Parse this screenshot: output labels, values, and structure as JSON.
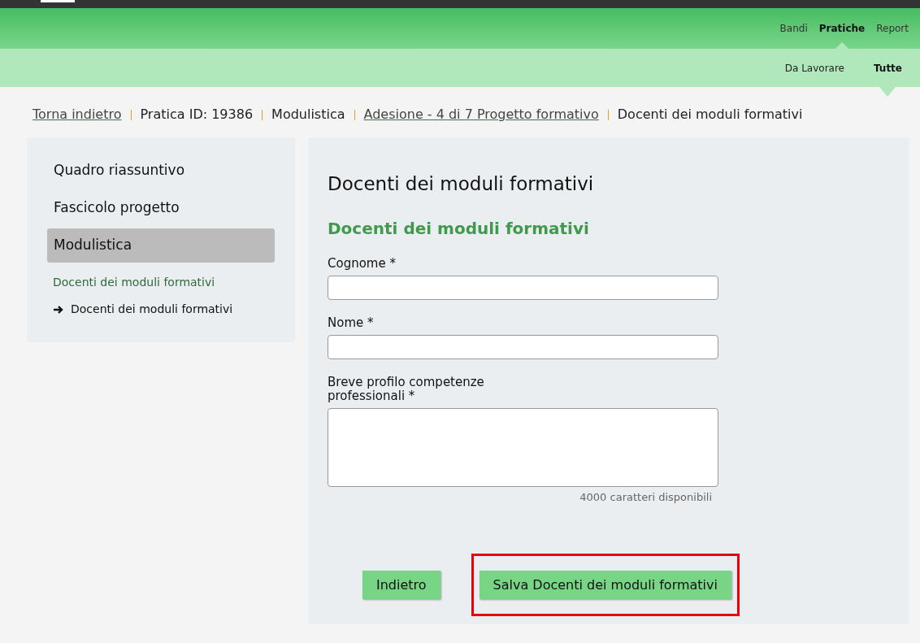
{
  "top_nav": [
    {
      "label": "Bandi",
      "selected": false
    },
    {
      "label": "Pratiche",
      "selected": true
    },
    {
      "label": "Report",
      "selected": false
    }
  ],
  "sub_nav": [
    {
      "label": "Da Lavorare",
      "selected": false
    },
    {
      "label": "Tutte",
      "selected": true
    }
  ],
  "breadcrumb": [
    {
      "label": "Torna indietro",
      "kind": "link"
    },
    {
      "label": "Pratica ID: 19386",
      "kind": "text"
    },
    {
      "label": "Modulistica",
      "kind": "text"
    },
    {
      "label": "Adesione - 4 di 7 Progetto formativo",
      "kind": "link"
    },
    {
      "label": "Docenti dei moduli formativi",
      "kind": "text"
    }
  ],
  "sidebar": {
    "items": [
      {
        "label": "Quadro riassuntivo",
        "selected": false
      },
      {
        "label": "Fascicolo progetto",
        "selected": false
      },
      {
        "label": "Modulistica",
        "selected": true
      }
    ],
    "section_title": "Docenti dei moduli formativi",
    "sub_items": [
      {
        "label": "Docenti dei moduli formativi",
        "current": true
      }
    ]
  },
  "form": {
    "title": "Docenti dei moduli formativi",
    "subtitle": "Docenti dei moduli formativi",
    "fields": [
      {
        "label": "Cognome *",
        "kind": "text"
      },
      {
        "label": "Nome *",
        "kind": "text"
      },
      {
        "label": "Breve profilo competenze professionali *",
        "kind": "textarea",
        "counter": "4000 caratteri disponibili"
      }
    ],
    "buttons": [
      {
        "label": "Indietro",
        "highlighted": false
      },
      {
        "label": "Salva Docenti dei moduli formativi",
        "highlighted": true
      }
    ]
  }
}
